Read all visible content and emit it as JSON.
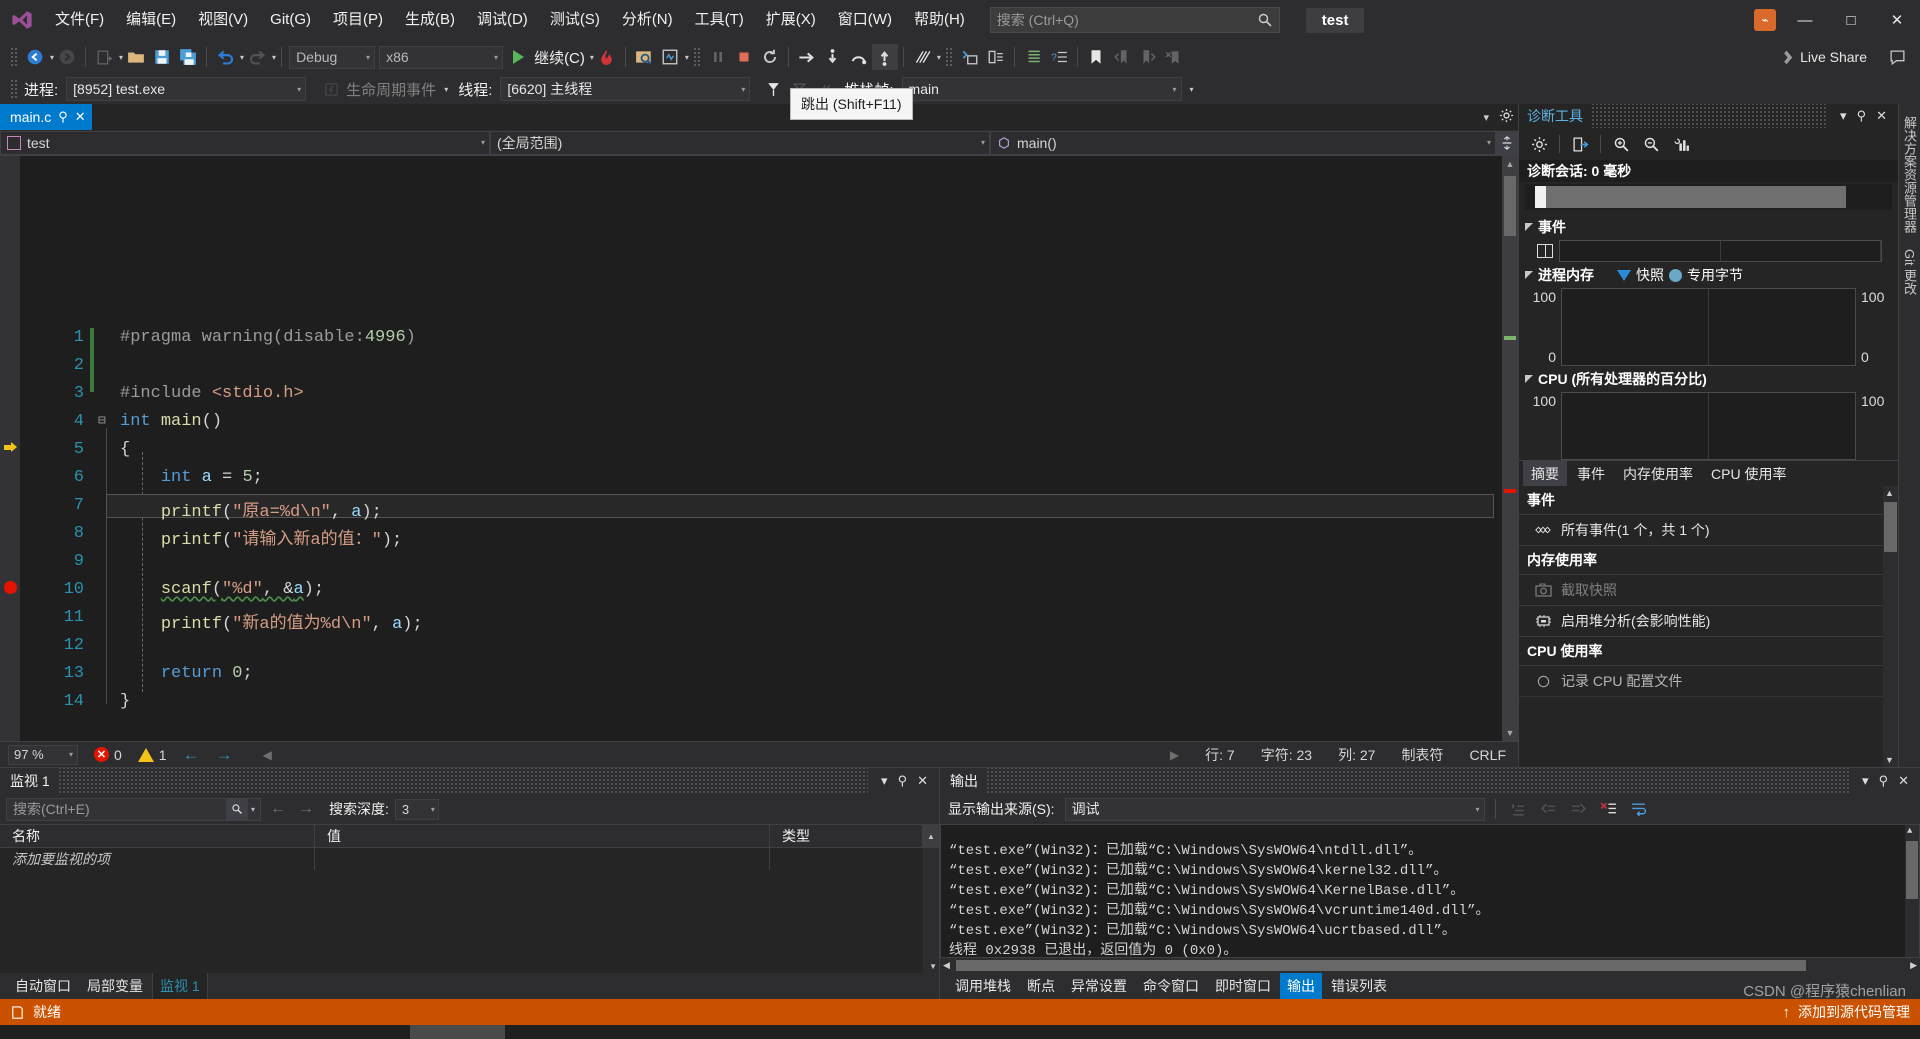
{
  "window": {
    "project_badge": "test",
    "minimize": "—",
    "maximize": "□",
    "close": "✕",
    "live_share": "Live Share"
  },
  "menu": {
    "items": [
      {
        "label": "文件(F)"
      },
      {
        "label": "编辑(E)"
      },
      {
        "label": "视图(V)"
      },
      {
        "label": "Git(G)"
      },
      {
        "label": "项目(P)"
      },
      {
        "label": "生成(B)"
      },
      {
        "label": "调试(D)"
      },
      {
        "label": "测试(S)"
      },
      {
        "label": "分析(N)"
      },
      {
        "label": "工具(T)"
      },
      {
        "label": "扩展(X)"
      },
      {
        "label": "窗口(W)"
      },
      {
        "label": "帮助(H)"
      }
    ]
  },
  "search": {
    "placeholder": "搜索 (Ctrl+Q)"
  },
  "toolbar": {
    "config": "Debug",
    "platform": "x86",
    "continue_label": "继续(C)"
  },
  "debugbar": {
    "process_label": "进程:",
    "process_value": "[8952] test.exe",
    "lifecycle_label": "生命周期事件",
    "thread_label": "线程:",
    "thread_value": "[6620] 主线程",
    "stack_label": "堆栈帧:",
    "stack_value": "main",
    "tooltip": "跳出 (Shift+F11)"
  },
  "editor": {
    "tab_name": "main.c",
    "class_scope": "test",
    "member_scope": "(全局范围)",
    "func_scope": "main()",
    "lines": [
      {
        "n": 1,
        "text": "#pragma warning(disable:4996)"
      },
      {
        "n": 2,
        "text": ""
      },
      {
        "n": 3,
        "text": "#include <stdio.h>"
      },
      {
        "n": 4,
        "text": "int main()"
      },
      {
        "n": 5,
        "text": "{"
      },
      {
        "n": 6,
        "text": "    int a = 5;"
      },
      {
        "n": 7,
        "text": "    printf(\"原a=%d\\n\", a);"
      },
      {
        "n": 8,
        "text": "    printf(\"请输入新a的值：\");"
      },
      {
        "n": 9,
        "text": ""
      },
      {
        "n": 10,
        "text": "    scanf(\"%d\", &a);"
      },
      {
        "n": 11,
        "text": "    printf(\"新a的值为%d\\n\", a);"
      },
      {
        "n": 12,
        "text": ""
      },
      {
        "n": 13,
        "text": "    return 0;"
      },
      {
        "n": 14,
        "text": "}"
      }
    ],
    "breakpoint_line": 10,
    "current_line": 5
  },
  "editor_status": {
    "zoom": "97 %",
    "errors": "0",
    "warnings": "1",
    "line": "行: 7",
    "char": "字符: 23",
    "col": "列: 27",
    "tabs": "制表符",
    "eol": "CRLF"
  },
  "diagnostics": {
    "title": "诊断工具",
    "session": "诊断会话: 0 毫秒",
    "events_section": "事件",
    "memory_section": "进程内存",
    "legend_snapshot": "快照",
    "legend_private": "专用字节",
    "cpu_section": "CPU (所有处理器的百分比)",
    "axis_max": "100",
    "axis_min": "0",
    "tabs": [
      {
        "label": "摘要",
        "active": true
      },
      {
        "label": "事件",
        "active": false
      },
      {
        "label": "内存使用率",
        "active": false
      },
      {
        "label": "CPU 使用率",
        "active": false
      }
    ],
    "summary": [
      {
        "type": "header",
        "label": "事件"
      },
      {
        "type": "row",
        "label": "所有事件(1 个，共 1 个)",
        "icon": "events-icon",
        "disabled": false
      },
      {
        "type": "header",
        "label": "内存使用率"
      },
      {
        "type": "row",
        "label": "截取快照",
        "icon": "camera-icon",
        "disabled": true
      },
      {
        "type": "row",
        "label": "启用堆分析(会影响性能)",
        "icon": "heap-icon",
        "disabled": false
      },
      {
        "type": "header",
        "label": "CPU 使用率"
      },
      {
        "type": "row",
        "label": "记录 CPU 配置文件",
        "icon": "record-icon",
        "disabled": false
      }
    ]
  },
  "vertical_tabs": [
    {
      "label": "解决方案资源管理器"
    },
    {
      "label": "Git 更改"
    }
  ],
  "watch": {
    "title": "监视 1",
    "search_placeholder": "搜索(Ctrl+E)",
    "depth_label": "搜索深度:",
    "depth_value": "3",
    "columns": [
      "名称",
      "值",
      "类型"
    ],
    "rows": [
      {
        "name": "添加要监视的项",
        "value": "",
        "type": ""
      }
    ],
    "tabs": [
      {
        "label": "自动窗口",
        "active": false
      },
      {
        "label": "局部变量",
        "active": false
      },
      {
        "label": "监视 1",
        "active": true
      }
    ]
  },
  "output": {
    "title": "输出",
    "source_label": "显示输出来源(S):",
    "source_value": "调试",
    "lines": [
      "“test.exe”(Win32)：已加载“C:\\Windows\\SysWOW64\\ntdll.dll”。",
      "“test.exe”(Win32)：已加载“C:\\Windows\\SysWOW64\\kernel32.dll”。",
      "“test.exe”(Win32)：已加载“C:\\Windows\\SysWOW64\\KernelBase.dll”。",
      "“test.exe”(Win32)：已加载“C:\\Windows\\SysWOW64\\vcruntime140d.dll”。",
      "“test.exe”(Win32)：已加载“C:\\Windows\\SysWOW64\\ucrtbased.dll”。",
      "线程 0x2938 已退出，返回值为 0 (0x0)。"
    ],
    "tabs": [
      {
        "label": "调用堆栈",
        "active": false
      },
      {
        "label": "断点",
        "active": false
      },
      {
        "label": "异常设置",
        "active": false
      },
      {
        "label": "命令窗口",
        "active": false
      },
      {
        "label": "即时窗口",
        "active": false
      },
      {
        "label": "输出",
        "active": true
      },
      {
        "label": "错误列表",
        "active": false
      }
    ]
  },
  "statusbar": {
    "state": "就绪",
    "source_control": "添加到源代码管理",
    "watermark": "CSDN @程序猿chenlian"
  },
  "colors": {
    "accent": "#007acc",
    "status_bg": "#ca5100",
    "breakpoint": "#e51400",
    "current_line_arrow": "#f0c419"
  }
}
